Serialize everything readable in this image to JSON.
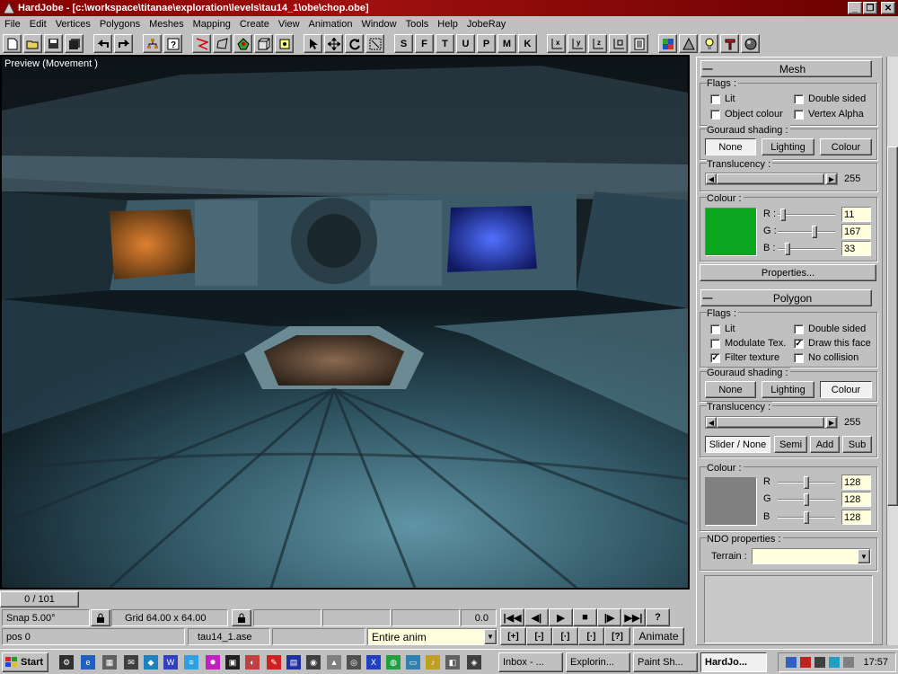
{
  "window": {
    "title": "HardJobe - [c:\\workspace\\titanae\\exploration\\levels\\tau14_1\\obe\\chop.obe]",
    "controls": [
      "_",
      "❐",
      "✕"
    ]
  },
  "menu": [
    "File",
    "Edit",
    "Vertices",
    "Polygons",
    "Meshes",
    "Mapping",
    "Create",
    "View",
    "Animation",
    "Window",
    "Tools",
    "Help",
    "JobeRay"
  ],
  "toolbar": {
    "letter_buttons": [
      "S",
      "F",
      "T",
      "U",
      "P",
      "M",
      "K"
    ]
  },
  "viewport": {
    "label": "Preview (Movement )"
  },
  "status": {
    "frame_counter": "0 / 101",
    "snap": "Snap 5.00°",
    "grid": "Grid 64.00 x 64.00",
    "time": "0.0",
    "pos": "pos 0",
    "file": "tau14_1.ase",
    "anim_select": "Entire anim",
    "animate_label": "Animate",
    "play_controls": [
      "|◀◀",
      "◀|",
      "▶",
      "■",
      "|▶",
      "▶▶|",
      "?"
    ],
    "key_controls": [
      "[+]",
      "[-]",
      "[·]",
      "[·]",
      "[?]"
    ]
  },
  "mesh": {
    "title": "Mesh",
    "flags_label": "Flags :",
    "flags": [
      {
        "label": "Lit",
        "checked": false
      },
      {
        "label": "Double sided",
        "checked": false
      },
      {
        "label": "Object colour",
        "checked": false
      },
      {
        "label": "Vertex Alpha",
        "checked": false
      }
    ],
    "gouraud_label": "Gouraud shading :",
    "gouraud_options": [
      "None",
      "Lighting",
      "Colour"
    ],
    "gouraud_selected": "None",
    "translucency_label": "Translucency :",
    "translucency_value": "255",
    "colour_label": "Colour :",
    "colour": {
      "r": "11",
      "g": "167",
      "b": "33",
      "hex": "#0ba721"
    },
    "channel_labels": [
      "R :",
      "G :",
      "B :"
    ],
    "properties_button": "Properties..."
  },
  "polygon": {
    "title": "Polygon",
    "flags_label": "Flags :",
    "flags": [
      {
        "label": "Lit",
        "checked": false
      },
      {
        "label": "Double sided",
        "checked": false
      },
      {
        "label": "Modulate Tex.",
        "checked": false
      },
      {
        "label": "Draw this face",
        "checked": true
      },
      {
        "label": "Filter texture",
        "checked": true
      },
      {
        "label": "No collision",
        "checked": false
      }
    ],
    "gouraud_label": "Gouraud shading :",
    "gouraud_options": [
      "None",
      "Lighting",
      "Colour"
    ],
    "gouraud_selected": "Colour",
    "translucency_label": "Translucency :",
    "translucency_value": "255",
    "blend_options": [
      "Slider / None",
      "Semi",
      "Add",
      "Sub"
    ],
    "blend_selected": "Slider / None",
    "colour_label": "Colour :",
    "colour": {
      "r": "128",
      "g": "128",
      "b": "128",
      "hex": "#808080"
    },
    "channel_labels": [
      "R",
      "G",
      "B"
    ],
    "ndo_label": "NDO properties :",
    "terrain_label": "Terrain :",
    "terrain_value": ""
  },
  "taskbar": {
    "start": "Start",
    "tasks": [
      "Inbox - ...",
      "Explorin...",
      "Paint Sh...",
      "HardJo..."
    ],
    "active_task": "HardJo...",
    "clock": "17:57"
  }
}
